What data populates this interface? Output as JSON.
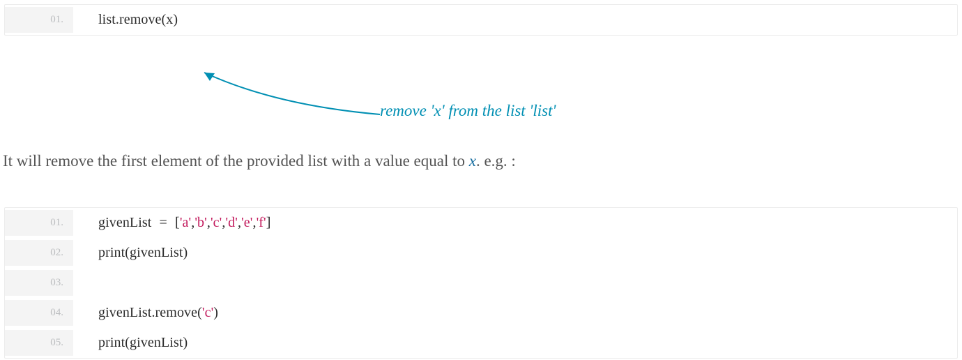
{
  "colors": {
    "teal": "#008fb3",
    "string": "#c2185b",
    "linenum": "#bcbec0",
    "gutter": "#f4f4f4"
  },
  "block1": {
    "lines": [
      {
        "num": "01.",
        "segments": [
          {
            "t": "list.remove(x)"
          }
        ]
      }
    ]
  },
  "annotation": {
    "text": "remove 'x' from the list 'list'"
  },
  "paragraph": {
    "pre": "It will remove the first element of the provided list with a value equal to ",
    "xvar": "x",
    "post": ". e.g. :"
  },
  "block2": {
    "lines": [
      {
        "num": "01.",
        "segments": [
          {
            "t": "givenList"
          },
          {
            "t": " = ",
            "cls": "op"
          },
          {
            "t": "["
          },
          {
            "t": "'a'",
            "cls": "str"
          },
          {
            "t": ","
          },
          {
            "t": "'b'",
            "cls": "str"
          },
          {
            "t": ","
          },
          {
            "t": "'c'",
            "cls": "str"
          },
          {
            "t": ","
          },
          {
            "t": "'d'",
            "cls": "str"
          },
          {
            "t": ","
          },
          {
            "t": "'e'",
            "cls": "str"
          },
          {
            "t": ","
          },
          {
            "t": "'f'",
            "cls": "str"
          },
          {
            "t": "]"
          }
        ]
      },
      {
        "num": "02.",
        "segments": [
          {
            "t": "print(givenList)"
          }
        ]
      },
      {
        "num": "03.",
        "segments": [
          {
            "t": " "
          }
        ]
      },
      {
        "num": "04.",
        "segments": [
          {
            "t": "givenList.remove("
          },
          {
            "t": "'c'",
            "cls": "str"
          },
          {
            "t": ")"
          }
        ]
      },
      {
        "num": "05.",
        "segments": [
          {
            "t": "print(givenList)"
          }
        ]
      }
    ]
  }
}
